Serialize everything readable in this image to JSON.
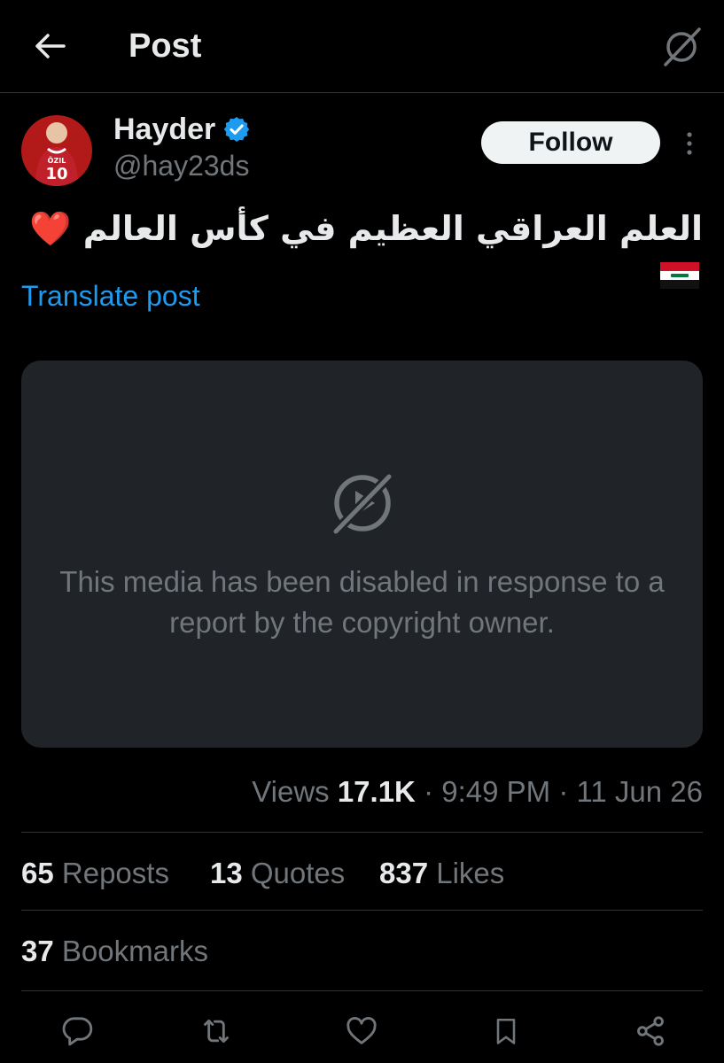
{
  "header": {
    "title": "Post"
  },
  "author": {
    "display_name": "Hayder",
    "handle": "@hay23ds",
    "avatar_jersey_name": "ÖZIL",
    "avatar_jersey_number": "10"
  },
  "follow_label": "Follow",
  "post": {
    "text": "العلم العراقي العظيم في كأس العالم",
    "emoji_heart": "❤️",
    "translate_label": "Translate post"
  },
  "media": {
    "message": "This media has been disabled in response to a report by the copyright owner."
  },
  "meta": {
    "views_label": "Views",
    "views_count": "17.1K",
    "time": "9:49 PM",
    "date": "11 Jun 26"
  },
  "stats": {
    "reposts_count": "65",
    "reposts_label": "Reposts",
    "quotes_count": "13",
    "quotes_label": "Quotes",
    "likes_count": "837",
    "likes_label": "Likes",
    "bookmarks_count": "37",
    "bookmarks_label": "Bookmarks"
  },
  "icons": {
    "back": "arrow-left-icon",
    "grok": "grok-icon",
    "verified": "verified-badge-icon",
    "more": "more-vertical-icon",
    "media_disabled": "media-disabled-icon",
    "reply": "reply-icon",
    "repost": "repost-icon",
    "like": "heart-icon",
    "bookmark": "bookmark-icon",
    "share": "share-icon"
  },
  "colors": {
    "background": "#000000",
    "text_primary": "#e7e9ea",
    "text_secondary": "#71767b",
    "accent": "#1d9bf0",
    "media_bg": "#202327",
    "follow_bg": "#eff3f4"
  }
}
